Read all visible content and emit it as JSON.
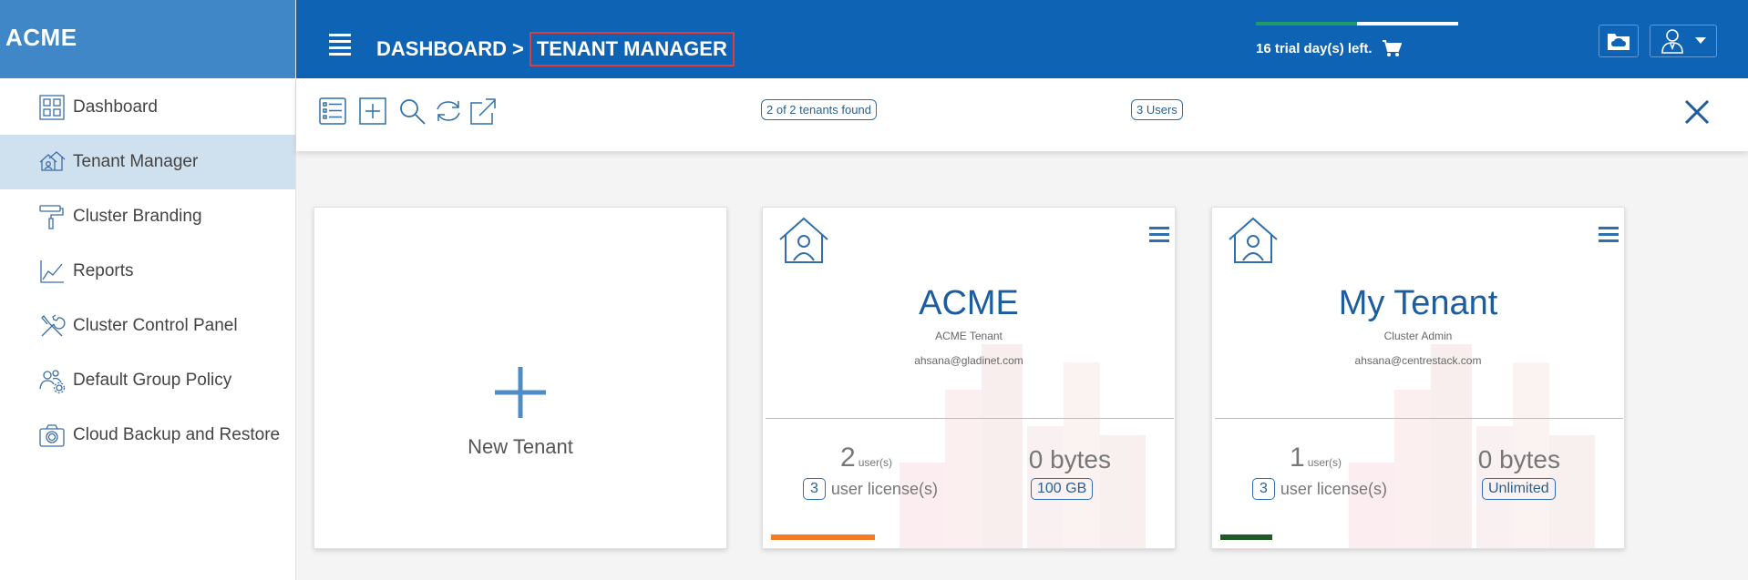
{
  "brand": "ACME",
  "sidebar": {
    "items": [
      {
        "label": "Dashboard",
        "icon": "dashboard-grid-icon"
      },
      {
        "label": "Tenant Manager",
        "icon": "tenant-houses-icon",
        "active": true
      },
      {
        "label": "Cluster Branding",
        "icon": "paint-roller-icon"
      },
      {
        "label": "Reports",
        "icon": "line-chart-icon"
      },
      {
        "label": "Cluster Control Panel",
        "icon": "wrench-screwdriver-icon"
      },
      {
        "label": "Default Group Policy",
        "icon": "users-gear-icon"
      },
      {
        "label": "Cloud Backup and Restore",
        "icon": "camera-icon"
      }
    ]
  },
  "header": {
    "crumb_root": "DASHBOARD",
    "crumb_sep": ">",
    "crumb_current": "TENANT MANAGER",
    "trial_text": "16 trial day(s) left.",
    "trial_progress": 0.5
  },
  "toolbar": {
    "tenants_found": "2 of 2 tenants found",
    "users_pill": "3 Users"
  },
  "new_tenant_label": "New Tenant",
  "tenants": [
    {
      "name": "ACME",
      "subtitle": "ACME Tenant",
      "email": "ahsana@gladinet.com",
      "users": "2",
      "users_unit": "user(s)",
      "licenses": "3",
      "licenses_label": "user license(s)",
      "storage": "0 bytes",
      "quota": "100 GB",
      "usage_fraction": 0.26,
      "usage_color": "#f47b20"
    },
    {
      "name": "My Tenant",
      "subtitle": "Cluster Admin",
      "email": "ahsana@centrestack.com",
      "users": "1",
      "users_unit": "user(s)",
      "licenses": "3",
      "licenses_label": "user license(s)",
      "storage": "0 bytes",
      "quota": "Unlimited",
      "usage_fraction": 0.13,
      "usage_color": "#1f5c25"
    }
  ],
  "colors": {
    "header_bg": "#0f63b5",
    "brand_bg": "#3f87c6",
    "active_nav": "#cfe0ef",
    "accent": "#1d5d9f"
  }
}
